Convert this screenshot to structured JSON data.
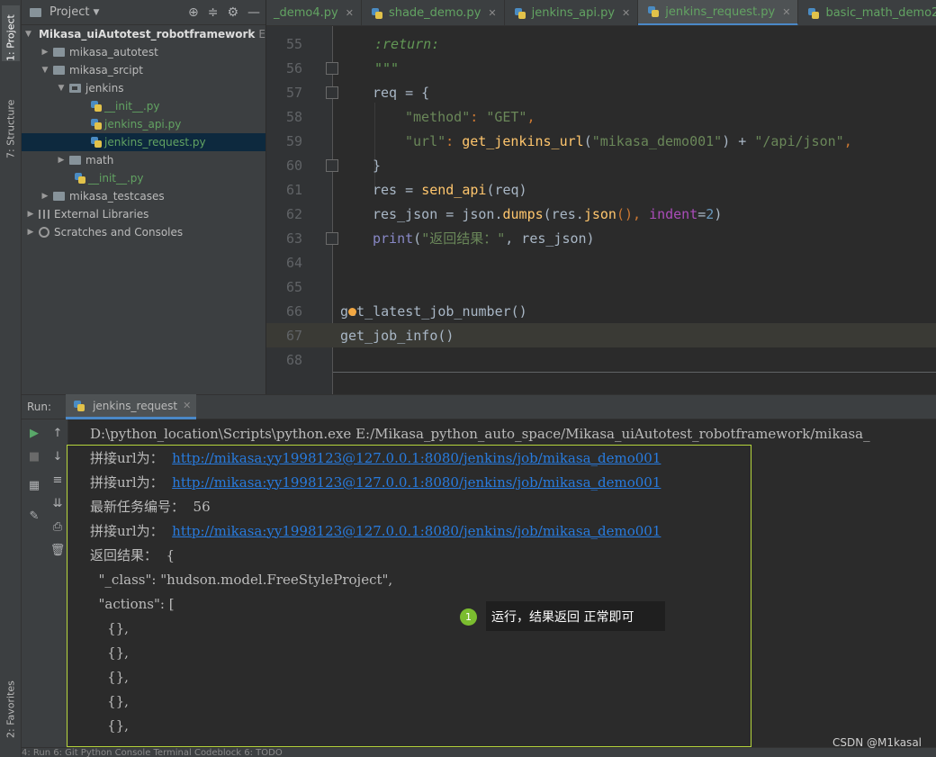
{
  "sidebar_tabs": {
    "project": "1: Project",
    "structure": "7: Structure",
    "favorites": "2: Favorites"
  },
  "project_panel": {
    "title": "Project",
    "tree": [
      {
        "label": "Mikasa_uiAutotest_robotframework",
        "suffix": "E",
        "level": 0,
        "type": "folder",
        "expanded": true
      },
      {
        "label": "mikasa_autotest",
        "level": 1,
        "type": "folder",
        "expanded": false
      },
      {
        "label": "mikasa_srcipt",
        "level": 1,
        "type": "folder",
        "expanded": true
      },
      {
        "label": "jenkins",
        "level": 2,
        "type": "package",
        "expanded": true
      },
      {
        "label": "__init__.py",
        "level": 3,
        "type": "py"
      },
      {
        "label": "jenkins_api.py",
        "level": 3,
        "type": "py"
      },
      {
        "label": "jenkins_request.py",
        "level": 3,
        "type": "py",
        "selected": true
      },
      {
        "label": "math",
        "level": 2,
        "type": "folder",
        "expanded": false
      },
      {
        "label": "__init__.py",
        "level": 2,
        "type": "py"
      },
      {
        "label": "mikasa_testcases",
        "level": 1,
        "type": "folder",
        "expanded": false
      },
      {
        "label": "External Libraries",
        "level": 0,
        "type": "lib",
        "expanded": false
      },
      {
        "label": "Scratches and Consoles",
        "level": 0,
        "type": "scratch",
        "expanded": false
      }
    ]
  },
  "editor_tabs": [
    {
      "label": "_demo4.py",
      "active": false
    },
    {
      "label": "shade_demo.py",
      "active": false
    },
    {
      "label": "jenkins_api.py",
      "active": false
    },
    {
      "label": "jenkins_request.py",
      "active": true
    },
    {
      "label": "basic_math_demo2.py",
      "active": false
    },
    {
      "label": "basic",
      "active": false
    }
  ],
  "code_lines": [
    {
      "n": "55"
    },
    {
      "n": "56"
    },
    {
      "n": "57"
    },
    {
      "n": "58"
    },
    {
      "n": "59"
    },
    {
      "n": "60"
    },
    {
      "n": "61"
    },
    {
      "n": "62"
    },
    {
      "n": "63"
    },
    {
      "n": "64"
    },
    {
      "n": "65"
    },
    {
      "n": "66"
    },
    {
      "n": "67"
    },
    {
      "n": "68"
    }
  ],
  "code": {
    "l55": ":return:",
    "l56": "\"\"\"",
    "l57_a": "req = {",
    "l58_key": "\"method\"",
    "l58_val": "\"GET\"",
    "l59_key": "\"url\"",
    "l59_fn": "get_jenkins_url",
    "l59_arg": "\"mikasa_demo001\"",
    "l59_tail": "\"/api/json\"",
    "l60": "}",
    "l61_a": "res = ",
    "l61_fn": "send_api",
    "l61_b": "(req)",
    "l62_a": "res_json = json.",
    "l62_fn": "dumps",
    "l62_b": "(res.",
    "l62_fn2": "json",
    "l62_c": "(), ",
    "l62_kw": "indent",
    "l62_eq": "=",
    "l62_num": "2",
    "l62_d": ")",
    "l63_fn": "print",
    "l63_str": "\"返回结果：\"",
    "l63_b": ", res_json)",
    "l66": "get_latest_job_number()",
    "l67": "get_job_info()"
  },
  "run_panel": {
    "label": "Run:",
    "tab": "jenkins_request",
    "console": [
      {
        "text": "D:\\python_location\\Scripts\\python.exe E:/Mikasa_python_auto_space/Mikasa_uiAutotest_robotframework/mikasa_",
        "link": ""
      },
      {
        "text": "拼接url为：  ",
        "link": "http://mikasa:yy1998123@127.0.0.1:8080/jenkins/job/mikasa_demo001"
      },
      {
        "text": "拼接url为：  ",
        "link": "http://mikasa:yy1998123@127.0.0.1:8080/jenkins/job/mikasa_demo001"
      },
      {
        "text": "最新任务编号：  56",
        "link": ""
      },
      {
        "text": "拼接url为：  ",
        "link": "http://mikasa:yy1998123@127.0.0.1:8080/jenkins/job/mikasa_demo001"
      },
      {
        "text": "返回结果：  {",
        "link": ""
      },
      {
        "text": "  \"_class\": \"hudson.model.FreeStyleProject\",",
        "link": ""
      },
      {
        "text": "  \"actions\": [",
        "link": ""
      },
      {
        "text": "    {},",
        "link": ""
      },
      {
        "text": "    {},",
        "link": ""
      },
      {
        "text": "    {},",
        "link": ""
      },
      {
        "text": "    {},",
        "link": ""
      },
      {
        "text": "    {},",
        "link": ""
      }
    ]
  },
  "annotation": {
    "badge": "1",
    "text": "运行，结果返回 正常即可"
  },
  "watermark": "CSDN @M1kasal",
  "bottom_bar": "4: Run   6: Git   Python Console   Terminal   Codeblock   6: TODO"
}
